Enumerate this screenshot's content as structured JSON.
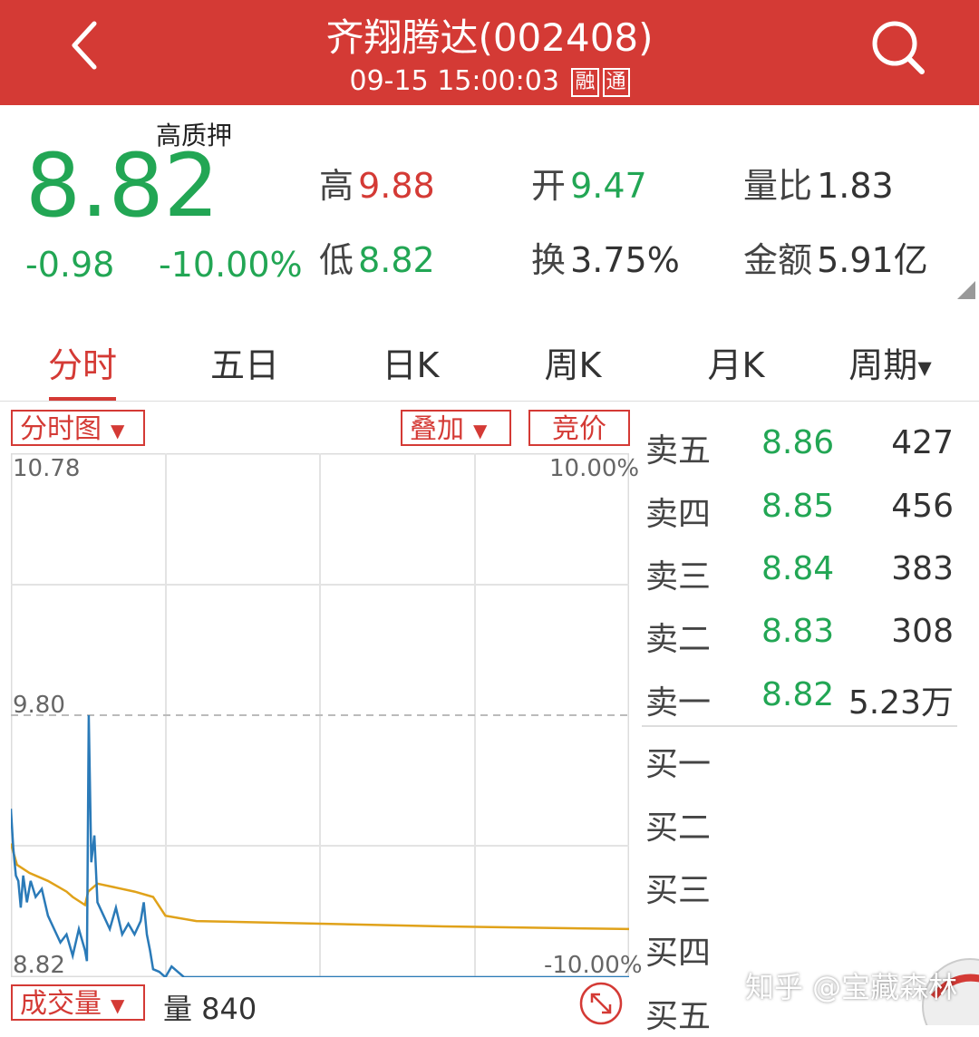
{
  "header": {
    "title": "齐翔腾达(002408)",
    "datetime": "09-15 15:00:03",
    "tag_margin": "融",
    "tag_connect": "通"
  },
  "quote": {
    "pledge_tag": "高质押",
    "price": "8.82",
    "change": "-0.98",
    "change_pct": "-10.00%",
    "high_label": "高",
    "high": "9.88",
    "low_label": "低",
    "low": "8.82",
    "open_label": "开",
    "open": "9.47",
    "turnover_label": "换",
    "turnover": "3.75%",
    "vol_ratio_label": "量比",
    "vol_ratio": "1.83",
    "amount_label": "金额",
    "amount": "5.91亿"
  },
  "tabs": [
    "分时",
    "五日",
    "日K",
    "周K",
    "月K",
    "周期"
  ],
  "controls": {
    "timeshare": "分时图",
    "overlay": "叠加",
    "auction": "竞价",
    "volume": "成交量"
  },
  "chart_axis": {
    "top_price": "10.78",
    "mid_price": "9.80",
    "bottom_price": "8.82",
    "top_pct": "10.00%",
    "bottom_pct": "-10.00%"
  },
  "orderbook": {
    "asks": [
      {
        "label": "卖五",
        "price": "8.86",
        "vol": "427"
      },
      {
        "label": "卖四",
        "price": "8.85",
        "vol": "456"
      },
      {
        "label": "卖三",
        "price": "8.84",
        "vol": "383"
      },
      {
        "label": "卖二",
        "price": "8.83",
        "vol": "308"
      },
      {
        "label": "卖一",
        "price": "8.82",
        "vol": "5.23万"
      }
    ],
    "bids": [
      {
        "label": "买一"
      },
      {
        "label": "买二"
      },
      {
        "label": "买三"
      },
      {
        "label": "买四"
      },
      {
        "label": "买五"
      }
    ]
  },
  "volume_info": "量 840",
  "watermark": "知乎 @宝藏森林",
  "colors": {
    "header_red": "#d43a35",
    "up_red": "#d43a35",
    "down_green": "#22a654",
    "price_line": "#2a7ab8",
    "avg_line": "#e0a21a"
  },
  "chart_data": {
    "type": "line",
    "ylim": [
      8.82,
      10.78
    ],
    "prev_close": 9.8,
    "series": [
      {
        "values_time_frac": [
          0,
          0.004,
          0.008,
          0.012,
          0.016,
          0.02,
          0.026,
          0.032,
          0.04,
          0.05,
          0.06,
          0.07,
          0.08,
          0.09,
          0.1,
          0.11,
          0.12,
          0.123,
          0.126,
          0.13,
          0.135,
          0.14,
          0.15,
          0.16,
          0.17,
          0.18,
          0.19,
          0.2,
          0.21,
          0.215,
          0.22,
          0.225,
          0.23,
          0.24,
          0.245,
          0.25,
          0.26,
          0.27,
          0.28,
          0.3,
          0.32,
          1.0
        ],
        "price": [
          9.45,
          9.3,
          9.2,
          9.18,
          9.08,
          9.2,
          9.1,
          9.18,
          9.12,
          9.15,
          9.05,
          9.0,
          8.95,
          8.98,
          8.9,
          9.0,
          8.92,
          8.88,
          9.8,
          9.25,
          9.35,
          9.1,
          9.05,
          9.0,
          9.08,
          8.98,
          9.02,
          8.98,
          9.03,
          9.1,
          8.98,
          8.92,
          8.85,
          8.84,
          8.83,
          8.82,
          8.86,
          8.84,
          8.82,
          8.82,
          8.82,
          8.82
        ]
      },
      {
        "values_time_frac": [
          0,
          0.01,
          0.03,
          0.06,
          0.09,
          0.1,
          0.12,
          0.125,
          0.14,
          0.2,
          0.23,
          0.25,
          0.3,
          0.5,
          0.7,
          1.0
        ],
        "avg": [
          9.32,
          9.24,
          9.21,
          9.18,
          9.14,
          9.12,
          9.09,
          9.14,
          9.17,
          9.14,
          9.12,
          9.05,
          9.03,
          9.02,
          9.01,
          9.0
        ]
      }
    ]
  }
}
